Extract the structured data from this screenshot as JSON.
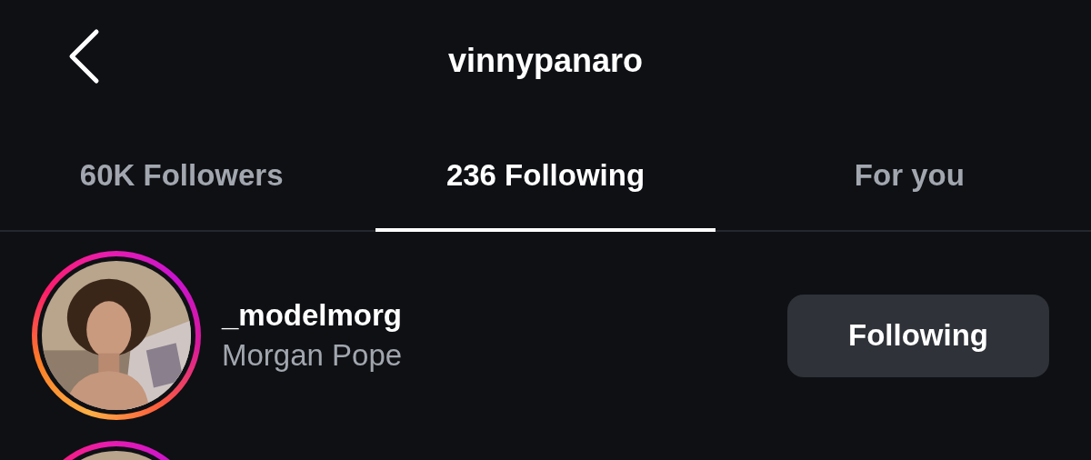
{
  "header": {
    "title": "vinnypanaro"
  },
  "tabs": [
    {
      "label": "60K Followers",
      "selected": false
    },
    {
      "label": "236 Following",
      "selected": true
    },
    {
      "label": "For you",
      "selected": false
    }
  ],
  "accounts": [
    {
      "username": "_modelmorg",
      "name": "Morgan Pope",
      "button": "Following",
      "story_ring": true
    },
    {
      "story_ring": true
    }
  ]
}
